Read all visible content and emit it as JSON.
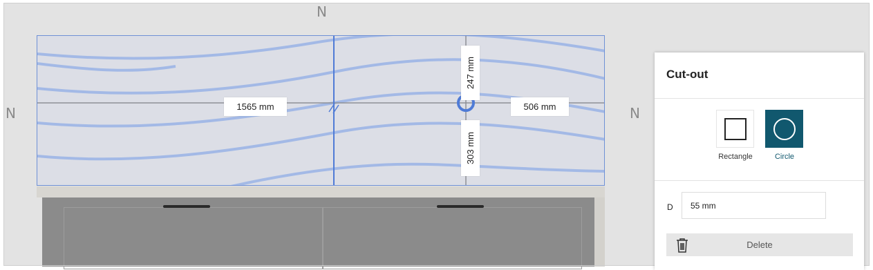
{
  "canvas": {
    "north_marker": "N",
    "dimensions": {
      "left_horizontal": "1565 mm",
      "right_horizontal": "506 mm",
      "top_vertical": "247 mm",
      "bottom_vertical": "303 mm"
    }
  },
  "panel": {
    "title": "Cut-out",
    "shapes": [
      {
        "label": "Rectangle",
        "selected": false
      },
      {
        "label": "Circle",
        "selected": true
      }
    ],
    "diameter": {
      "label": "D",
      "value": "55 mm"
    },
    "delete_label": "Delete"
  },
  "colors": {
    "accent": "#11586e",
    "outline_blue": "#5b86d6",
    "wave_blue": "#9db6e6"
  },
  "icons": {
    "rectangle": "square-outline-icon",
    "circle": "circle-outline-icon",
    "delete": "trash-icon",
    "north": "north-arrow-icon"
  }
}
